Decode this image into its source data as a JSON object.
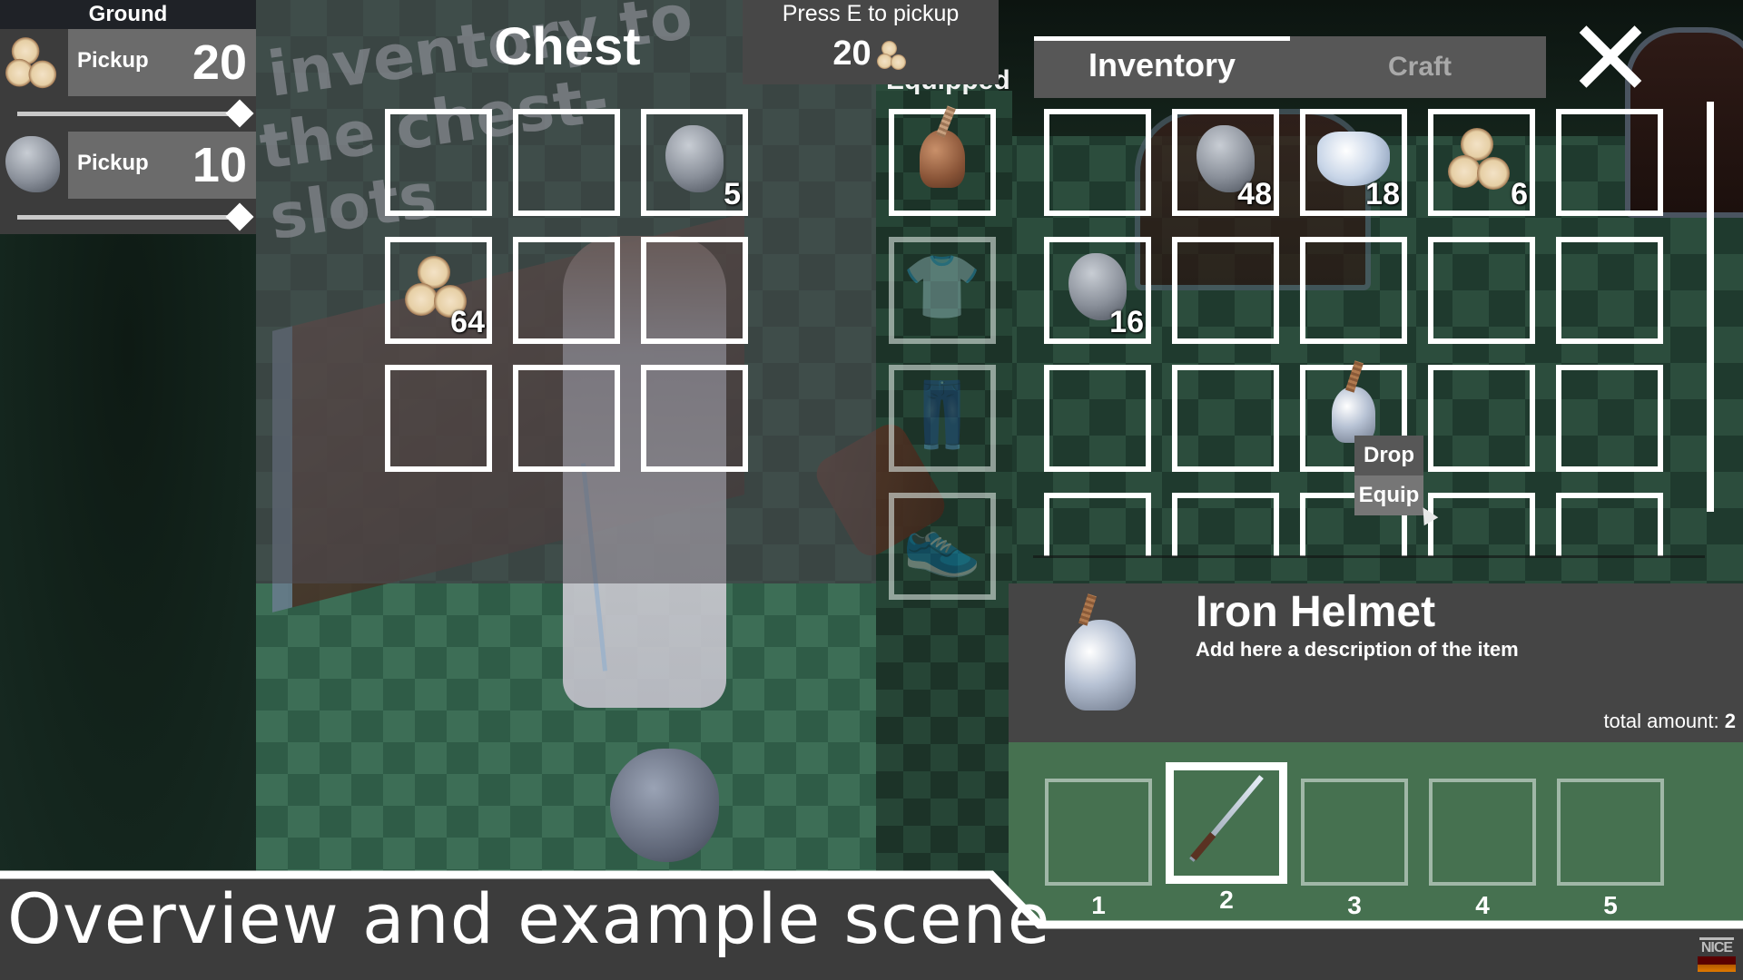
{
  "ground": {
    "title": "Ground",
    "rows": [
      {
        "icon": "logs-icon",
        "label": "Pickup",
        "amount": "20",
        "slider_fraction": 1.0
      },
      {
        "icon": "stone-icon",
        "label": "Pickup",
        "amount": "10",
        "slider_fraction": 1.0
      }
    ]
  },
  "chest": {
    "title": "Chest",
    "sign_text": [
      "inventory to",
      "the chest-slots"
    ],
    "slots": [
      {
        "icon": null,
        "count": ""
      },
      {
        "icon": null,
        "count": ""
      },
      {
        "icon": "stone-icon",
        "count": "5"
      },
      {
        "icon": "logs-icon",
        "count": "64"
      },
      {
        "icon": null,
        "count": ""
      },
      {
        "icon": null,
        "count": ""
      },
      {
        "icon": null,
        "count": ""
      },
      {
        "icon": null,
        "count": ""
      },
      {
        "icon": null,
        "count": ""
      }
    ]
  },
  "pickup_prompt": {
    "text": "Press E to pickup",
    "amount": "20",
    "icon": "logs-icon"
  },
  "equipped": {
    "label": "Equipped",
    "slots": [
      {
        "name": "head",
        "icon": "leather-helmet-icon",
        "filled": true
      },
      {
        "name": "chest",
        "icon": "shirt-icon",
        "filled": false
      },
      {
        "name": "legs",
        "icon": "pants-icon",
        "filled": false
      },
      {
        "name": "feet",
        "icon": "shoe-icon",
        "filled": false
      }
    ]
  },
  "inventory": {
    "tabs": [
      {
        "label": "Inventory",
        "active": true
      },
      {
        "label": "Craft",
        "active": false
      }
    ],
    "close_icon": "close-icon",
    "slots": [
      {
        "icon": null,
        "count": ""
      },
      {
        "icon": "stone-icon",
        "count": "48"
      },
      {
        "icon": "crystal-icon",
        "count": "18"
      },
      {
        "icon": "logs-icon",
        "count": "6"
      },
      {
        "icon": null,
        "count": ""
      },
      {
        "icon": "stone-icon",
        "count": "16"
      },
      {
        "icon": null,
        "count": ""
      },
      {
        "icon": null,
        "count": ""
      },
      {
        "icon": null,
        "count": ""
      },
      {
        "icon": null,
        "count": ""
      },
      {
        "icon": null,
        "count": ""
      },
      {
        "icon": null,
        "count": ""
      },
      {
        "icon": "iron-helmet-icon",
        "count": ""
      },
      {
        "icon": null,
        "count": ""
      },
      {
        "icon": null,
        "count": ""
      },
      {
        "icon": null,
        "count": ""
      },
      {
        "icon": null,
        "count": ""
      },
      {
        "icon": null,
        "count": ""
      },
      {
        "icon": null,
        "count": ""
      },
      {
        "icon": null,
        "count": ""
      }
    ],
    "context_menu": {
      "items": [
        "Drop",
        "Equip"
      ],
      "hovered": "Equip"
    }
  },
  "details": {
    "name": "Iron Helmet",
    "description": "Add here a description of the item",
    "total_label": "total amount:",
    "total_value": "2",
    "icon": "iron-helmet-icon"
  },
  "hotbar": {
    "selected": 2,
    "slots": [
      {
        "number": "1",
        "icon": null
      },
      {
        "number": "2",
        "icon": "sword-icon"
      },
      {
        "number": "3",
        "icon": null
      },
      {
        "number": "4",
        "icon": null
      },
      {
        "number": "5",
        "icon": null
      }
    ]
  },
  "banner": {
    "text": "Overview and example scene"
  },
  "logo": {
    "text": "NICE"
  },
  "colors": {
    "panel_gray": "#454545",
    "hotbar_green": "#467150",
    "banner_dark": "#3c3c3c",
    "slot_border": "#ffffff"
  }
}
